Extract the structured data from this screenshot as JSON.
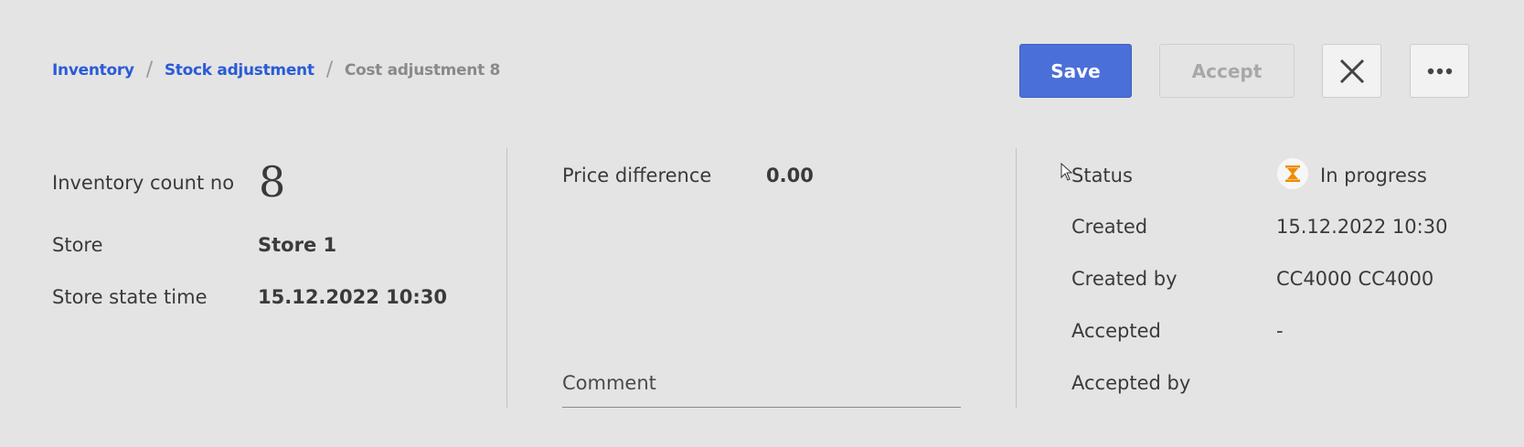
{
  "breadcrumb": {
    "items": [
      "Inventory",
      "Stock adjustment"
    ],
    "current": "Cost adjustment 8",
    "separator": "/"
  },
  "toolbar": {
    "save_label": "Save",
    "accept_label": "Accept",
    "close_icon": "close-icon",
    "more_icon": "more-horizontal-icon"
  },
  "left": {
    "count_label": "Inventory count no",
    "count_value": "8",
    "store_label": "Store",
    "store_value": "Store 1",
    "state_time_label": "Store state time",
    "state_time_value": "15.12.2022 10:30"
  },
  "middle": {
    "price_diff_label": "Price difference",
    "price_diff_value": "0.00",
    "comment_label": "Comment"
  },
  "right": {
    "status_label": "Status",
    "status_value": "In progress",
    "status_icon": "hourglass-icon",
    "created_label": "Created",
    "created_value": "15.12.2022 10:30",
    "created_by_label": "Created by",
    "created_by_value": "CC4000 CC4000",
    "accepted_label": "Accepted",
    "accepted_value": "-",
    "accepted_by_label": "Accepted by",
    "accepted_by_value": ""
  },
  "colors": {
    "accent": "#4a6fd8",
    "link": "#2a5bd7",
    "status_icon": "#f08c00",
    "background": "#e4e4e4"
  }
}
